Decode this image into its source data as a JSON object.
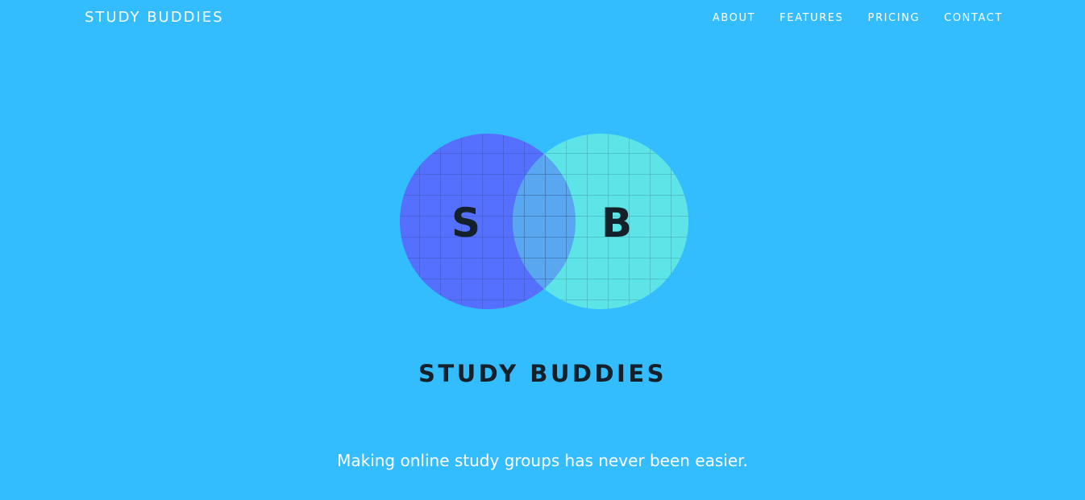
{
  "header": {
    "brand": "STUDY BUDDIES",
    "nav": {
      "about": "ABOUT",
      "features": "FEATURES",
      "pricing": "PRICING",
      "contact": "CONTACT"
    }
  },
  "hero": {
    "logo": {
      "left_letter": "S",
      "right_letter": "B",
      "wordmark": "STUDY BUDDIES"
    },
    "tagline": "Making online study groups has never been easier."
  },
  "colors": {
    "background": "#33bdff",
    "left_circle": "#5570ff",
    "right_circle": "#5ce4e6",
    "overlap": "#59a6f1",
    "text_dark": "#14202a",
    "text_light": "#ffffff"
  }
}
